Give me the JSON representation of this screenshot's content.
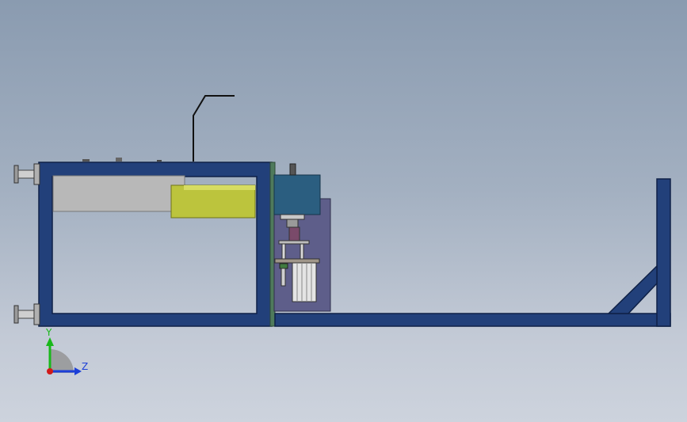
{
  "viewport": {
    "background_top": "#8a9bb0",
    "background_bottom": "#cdd3dd"
  },
  "colors": {
    "frame": "#22407a",
    "frame_edge": "#0f2147",
    "gray_block": "#b8b8b8",
    "yellow_block": "#bcc43d",
    "teal_box": "#2b5e80",
    "purple_plate": "#5e5e8a",
    "green_strip": "#4f7a5c"
  },
  "triad": {
    "y_label": "Y",
    "z_label": "Z",
    "y_color": "#19b81a",
    "z_color": "#1c3fd8",
    "origin_color": "#d11a1a"
  }
}
